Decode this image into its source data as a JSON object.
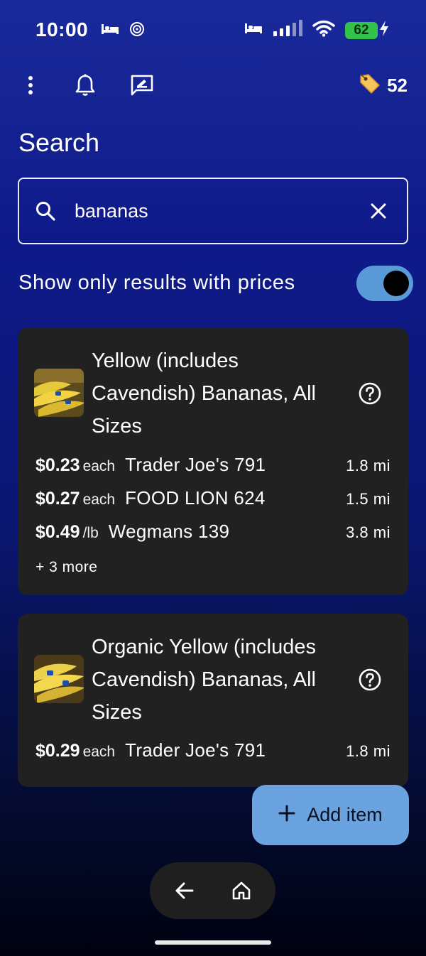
{
  "status_bar": {
    "time": "10:00",
    "battery_level": "62",
    "battery_color": "#33c24a"
  },
  "toolbar": {
    "tag_count": "52"
  },
  "page": {
    "title": "Search"
  },
  "search": {
    "value": "bananas",
    "placeholder": ""
  },
  "filter": {
    "label": "Show only results with prices",
    "enabled": true,
    "accent_color": "#5b9ad8"
  },
  "results": [
    {
      "title": "Yellow (includes Cavendish) Bananas, All Sizes",
      "prices": [
        {
          "price": "$0.23",
          "unit": "each",
          "store": "Trader Joe's 791",
          "distance": "1.8 mi"
        },
        {
          "price": "$0.27",
          "unit": "each",
          "store": "FOOD LION 624",
          "distance": "1.5 mi"
        },
        {
          "price": "$0.49",
          "unit": "/lb",
          "store": "Wegmans 139",
          "distance": "3.8 mi"
        }
      ],
      "more": "+ 3 more"
    },
    {
      "title": "Organic Yellow (includes Cavendish) Bananas, All Sizes",
      "prices": [
        {
          "price": "$0.29",
          "unit": "each",
          "store": "Trader Joe's 791",
          "distance": "1.8 mi"
        }
      ]
    }
  ],
  "fab": {
    "label": "Add item",
    "color": "#6aa3df"
  },
  "icons": {
    "menu": "more-vert-icon",
    "notifications": "bell-icon",
    "feedback": "feedback-icon",
    "tag": "tag-icon",
    "search": "search-icon",
    "clear": "close-icon",
    "help": "help-circle-icon",
    "add": "plus-icon",
    "back": "arrow-left-icon",
    "home": "home-icon"
  }
}
